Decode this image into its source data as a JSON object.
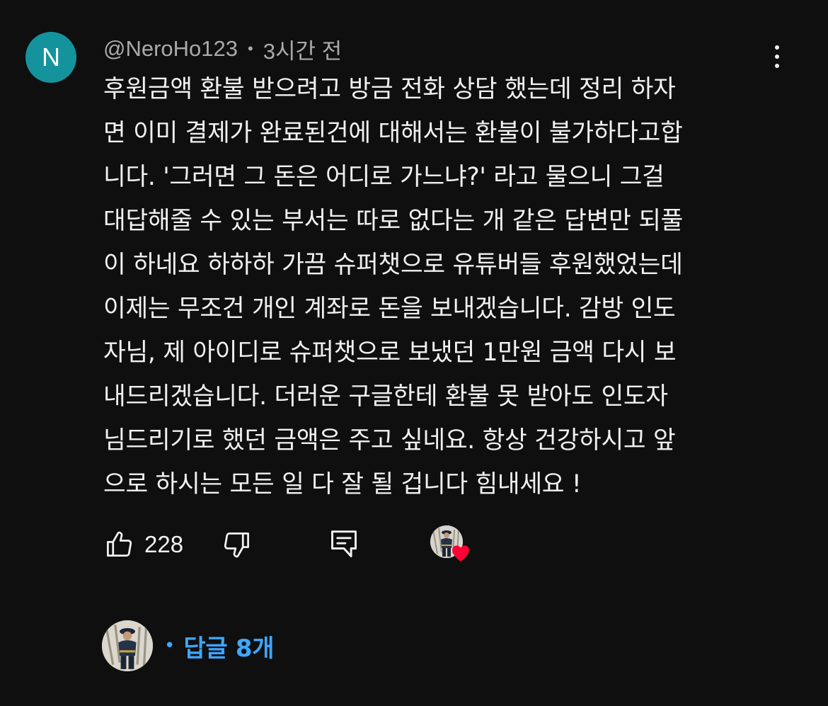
{
  "colors": {
    "background": "#0f0f0f",
    "text_primary": "#f1f1f1",
    "text_secondary": "#aaaaaa",
    "avatar_bg": "#14939d",
    "link_blue": "#3ea6ff",
    "heart_red": "#ff0033"
  },
  "comment": {
    "avatar_letter": "N",
    "author": "@NeroHo123",
    "separator": "•",
    "time": "3시간 전",
    "more_icon": "more-vert-icon",
    "body_lines": [
      "후원금액 환불 받으려고 방금 전화 상담 했는데 정리 하자",
      "면 이미 결제가 완료된건에 대해서는 환불이 불가하다고합",
      "니다. '그러면 그 돈은 어디로 가느냐?' 라고 물으니 그걸",
      "대답해줄 수 있는 부서는 따로 없다는 개 같은 답변만 되풀",
      "이 하네요 하하하 가끔 슈퍼챗으로 유튜버들 후원했었는데",
      "이제는 무조건 개인 계좌로 돈을 보내겠습니다. 감방 인도",
      "자님, 제 아이디로 슈퍼챗으로 보냈던 1만원 금액 다시 보",
      "내드리겠습니다. 더러운 구글한테 환불 못 받아도 인도자",
      "님드리기로 했던 금액은 주고 싶네요. 항상 건강하시고 앞",
      "으로 하시는 모든 일 다 잘 될 겁니다 힘내세요 !"
    ]
  },
  "actions": {
    "like_icon": "thumb-up-icon",
    "like_count": "228",
    "dislike_icon": "thumb-down-icon",
    "reply_icon": "reply-comment-icon",
    "creator_heart_icon": "creator-heart-icon"
  },
  "replies": {
    "separator": "•",
    "label": "답글 8개"
  }
}
